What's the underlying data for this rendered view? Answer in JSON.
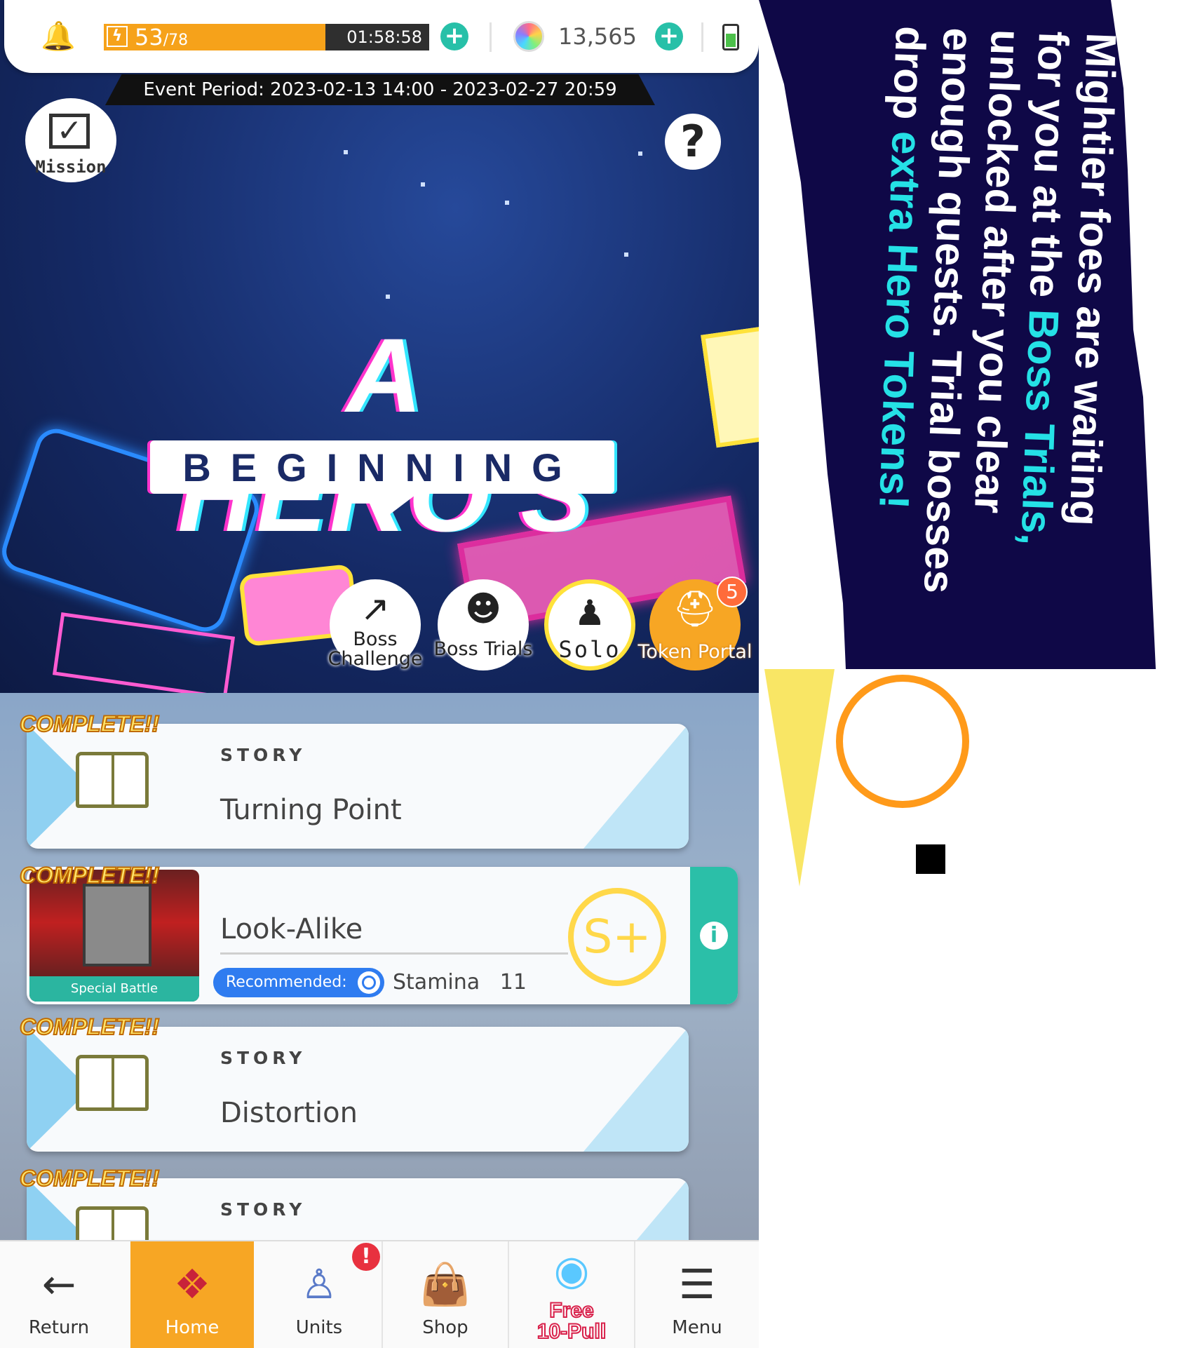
{
  "header": {
    "stamina_current": "53",
    "stamina_max": "/78",
    "stamina_fraction": 0.68,
    "stamina_timer": "01:58:58",
    "gems": "13,565",
    "battery_level": 0.6
  },
  "event": {
    "period": "Event Period: 2023-02-13 14:00 - 2023-02-27 20:59"
  },
  "banner": {
    "title": "A HERO'S",
    "subtitle": "BEGINNING",
    "mission_label": "Mission",
    "help": "?"
  },
  "modes": [
    {
      "label": "Boss Challenge"
    },
    {
      "label": "Boss Trials"
    },
    {
      "label": "Solo"
    },
    {
      "label": "Token Portal",
      "badge": "5"
    }
  ],
  "quests": {
    "complete_label": "COMPLETE!!",
    "items": [
      {
        "tag": "STORY",
        "title": "Turning Point"
      },
      {
        "title": "Look-Alike",
        "image_label": "Special Battle",
        "recommended": "Recommended:",
        "stamina": "Stamina   11",
        "rank": "S+"
      },
      {
        "tag": "STORY",
        "title": "Distortion"
      },
      {
        "tag": "STORY",
        "title": ""
      }
    ]
  },
  "nav": {
    "return": "Return",
    "home": "Home",
    "units": "Units",
    "units_badge": "!",
    "shop": "Shop",
    "free_pull_top": "Free",
    "free_pull_bottom": "10-Pull",
    "menu": "Menu"
  },
  "promo": {
    "line1": "Mightier foes are waiting",
    "line2a": "for you at the ",
    "line2b": "Boss Trials,",
    "line3": "unlocked after you clear",
    "line4": "enough quests. Trial bosses",
    "line5a": "drop ",
    "line5b": "extra Hero Tokens!"
  },
  "colors": {
    "accent": "#f7a624",
    "teal": "#27c0a8",
    "promo_bg": "#0f0847",
    "highlight": "#25e1e6",
    "complete": "#ffe46a"
  }
}
